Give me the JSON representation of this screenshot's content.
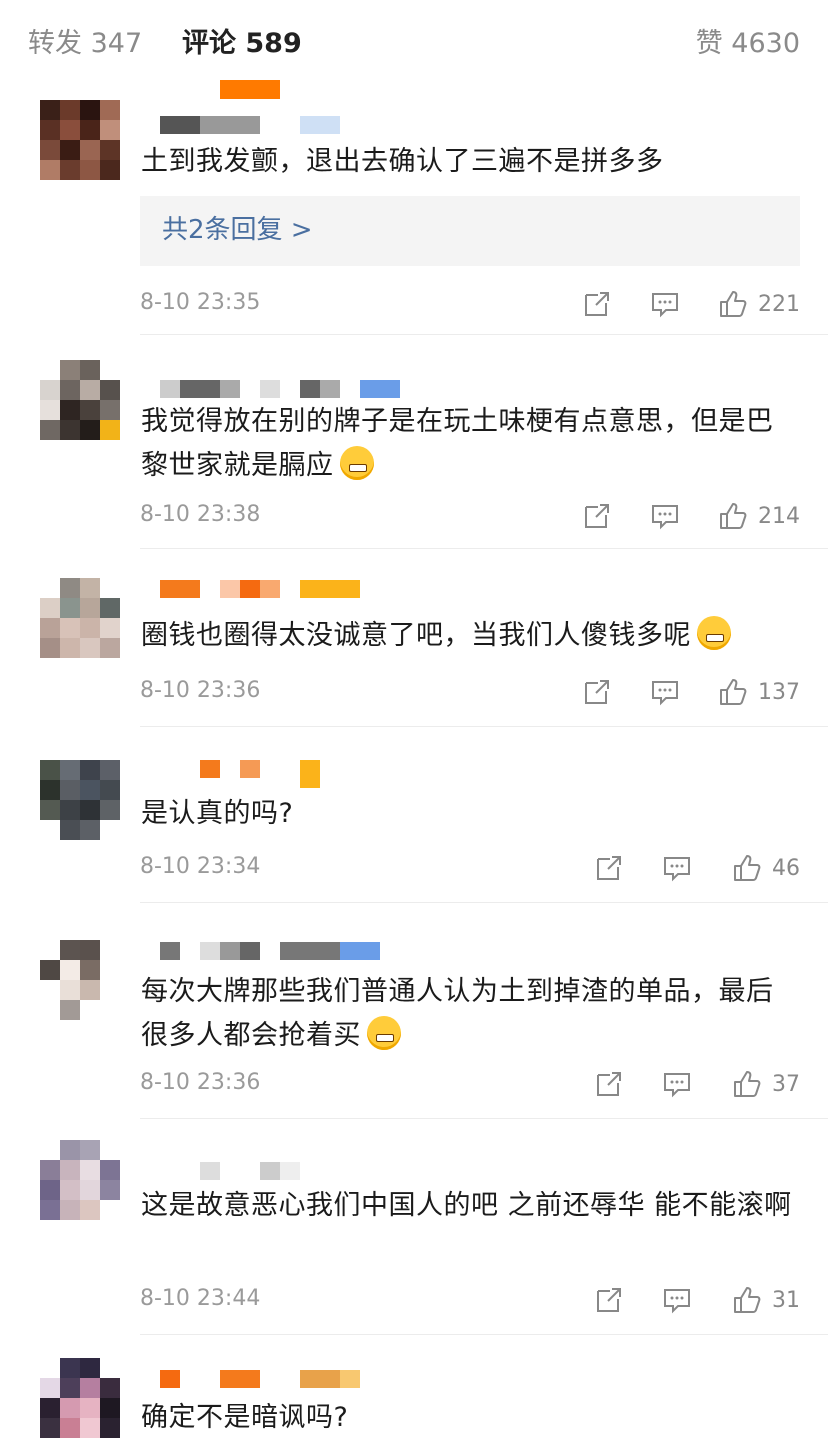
{
  "tabs": {
    "repost": "转发 347",
    "comments": "评论 589",
    "likes": "赞 4630"
  },
  "colors": {
    "accent": "#ff7a00",
    "link": "#4a6fa0",
    "meta_text": "#9a9a9a"
  },
  "comments": [
    {
      "text": "土到我发颤，退出去确认了三遍不是拼多多",
      "reply_link": "共2条回复 >",
      "time": "8-10 23:35",
      "likes": "221"
    },
    {
      "text": "我觉得放在别的牌子是在玩土味梗有点意思，但是巴黎世家就是膈应",
      "emoji": "grinning-emoji",
      "time": "8-10 23:38",
      "likes": "214"
    },
    {
      "text": "圈钱也圈得太没诚意了吧，当我们人傻钱多呢",
      "emoji": "smirk-emoji",
      "time": "8-10 23:36",
      "likes": "137"
    },
    {
      "text": "是认真的吗?",
      "time": "8-10 23:34",
      "likes": "46"
    },
    {
      "text": "每次大牌那些我们普通人认为土到掉渣的单品，最后很多人都会抢着买",
      "emoji": "shush-emoji",
      "time": "8-10 23:36",
      "likes": "37"
    },
    {
      "text": "这是故意恶心我们中国人的吧 之前还辱华 能不能滚啊",
      "time": "8-10 23:44",
      "likes": "31"
    },
    {
      "text": "确定不是暗讽吗?"
    }
  ]
}
